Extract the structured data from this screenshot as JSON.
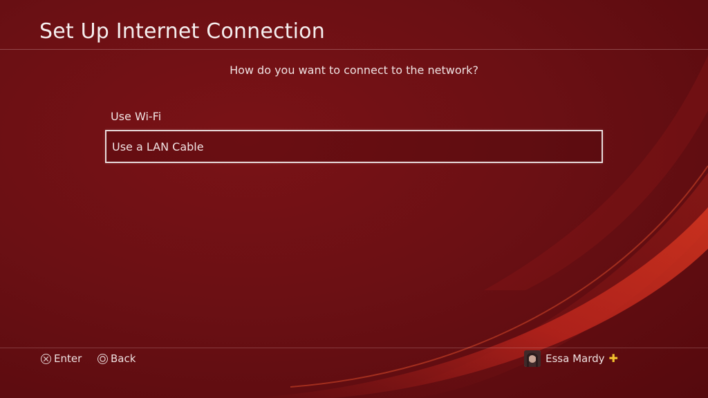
{
  "header": {
    "title": "Set Up Internet Connection"
  },
  "main": {
    "prompt": "How do you want to connect to the network?",
    "options": [
      {
        "label": "Use Wi-Fi",
        "selected": false
      },
      {
        "label": "Use a LAN Cable",
        "selected": true
      }
    ]
  },
  "footer": {
    "enter_label": "Enter",
    "enter_icon": "cross-button-icon",
    "back_label": "Back",
    "back_icon": "circle-button-icon",
    "user": {
      "name": "Essa Mardy",
      "avatar_icon": "user-avatar",
      "plus_icon": "playstation-plus-icon"
    }
  },
  "colors": {
    "background": "#6b1014",
    "accent_wave": "#b8241c",
    "plus": "#f2c12e",
    "text": "#f3e8e8"
  }
}
